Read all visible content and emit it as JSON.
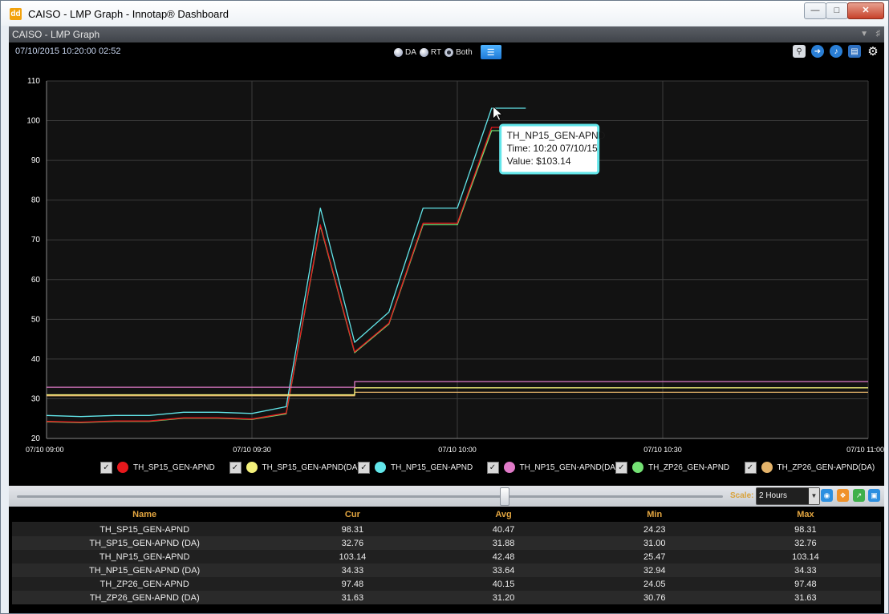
{
  "window": {
    "title": "CAISO - LMP Graph - Innotap® Dashboard",
    "app_icon": "dd"
  },
  "panel": {
    "title": "CAISO - LMP Graph"
  },
  "toolbar": {
    "timestamp": "07/10/2015 10:20:00  02:52",
    "modes": [
      {
        "label": "DA",
        "selected": false
      },
      {
        "label": "RT",
        "selected": false
      },
      {
        "label": "Both",
        "selected": true
      }
    ],
    "icons": [
      "zoom-icon",
      "forward-icon",
      "sound-icon",
      "save-icon",
      "settings-icon"
    ]
  },
  "chart_data": {
    "type": "line",
    "xlabel": "",
    "ylabel": "",
    "ylim": [
      20,
      110
    ],
    "yticks": [
      20,
      30,
      40,
      50,
      60,
      70,
      80,
      90,
      100,
      110
    ],
    "xlim": [
      "07/10 09:00",
      "07/10 11:00"
    ],
    "xticks": [
      "07/10 09:00",
      "07/10 09:30",
      "07/10 10:00",
      "07/10 10:30",
      "07/10 11:00"
    ],
    "grid": true,
    "series": [
      {
        "name": "TH_SP15_GEN-APND",
        "color": "#e8181c",
        "points": [
          [
            "09:00",
            24.3
          ],
          [
            "09:05",
            24.1
          ],
          [
            "09:10",
            24.4
          ],
          [
            "09:15",
            24.4
          ],
          [
            "09:20",
            25.2
          ],
          [
            "09:25",
            25.2
          ],
          [
            "09:30",
            24.9
          ],
          [
            "09:35",
            26.4
          ],
          [
            "09:40",
            73.8
          ],
          [
            "09:45",
            41.8
          ],
          [
            "09:50",
            49.0
          ],
          [
            "09:55",
            74.2
          ],
          [
            "10:00",
            74.2
          ],
          [
            "10:05",
            98.31
          ],
          [
            "10:10",
            98.31
          ]
        ]
      },
      {
        "name": "TH_SP15_GEN-APND(DA)",
        "color": "#f3f07a",
        "points": [
          [
            "09:00",
            31.0
          ],
          [
            "09:45",
            31.0
          ],
          [
            "09:45",
            32.76
          ],
          [
            "11:00",
            32.76
          ]
        ]
      },
      {
        "name": "TH_NP15_GEN-APND",
        "color": "#62e6ea",
        "points": [
          [
            "09:00",
            25.8
          ],
          [
            "09:05",
            25.5
          ],
          [
            "09:10",
            25.8
          ],
          [
            "09:15",
            25.8
          ],
          [
            "09:20",
            26.6
          ],
          [
            "09:25",
            26.6
          ],
          [
            "09:30",
            26.3
          ],
          [
            "09:35",
            28.0
          ],
          [
            "09:40",
            78.0
          ],
          [
            "09:45",
            44.2
          ],
          [
            "09:50",
            51.8
          ],
          [
            "09:55",
            78.0
          ],
          [
            "10:00",
            78.0
          ],
          [
            "10:05",
            103.14
          ],
          [
            "10:10",
            103.14
          ]
        ]
      },
      {
        "name": "TH_NP15_GEN-APND(DA)",
        "color": "#e07ac8",
        "points": [
          [
            "09:00",
            32.9
          ],
          [
            "09:45",
            32.9
          ],
          [
            "09:45",
            34.33
          ],
          [
            "11:00",
            34.33
          ]
        ]
      },
      {
        "name": "TH_ZP26_GEN-APND",
        "color": "#74e174",
        "points": [
          [
            "09:00",
            24.2
          ],
          [
            "09:05",
            24.0
          ],
          [
            "09:10",
            24.3
          ],
          [
            "09:15",
            24.3
          ],
          [
            "09:20",
            25.1
          ],
          [
            "09:25",
            25.1
          ],
          [
            "09:30",
            24.8
          ],
          [
            "09:35",
            26.2
          ],
          [
            "09:40",
            73.5
          ],
          [
            "09:45",
            41.6
          ],
          [
            "09:50",
            48.8
          ],
          [
            "09:55",
            73.8
          ],
          [
            "10:00",
            73.8
          ],
          [
            "10:05",
            97.48
          ],
          [
            "10:10",
            97.48
          ]
        ]
      },
      {
        "name": "TH_ZP26_GEN-APND(DA)",
        "color": "#e4b36a",
        "points": [
          [
            "09:00",
            30.76
          ],
          [
            "09:45",
            30.76
          ],
          [
            "09:45",
            31.63
          ],
          [
            "11:00",
            31.63
          ]
        ]
      }
    ],
    "tooltip": {
      "series": "TH_NP15_GEN-APND",
      "time_line": "Time: 10:20 07/10/15",
      "value_line": "Value: $103.14",
      "at_x": "10:05",
      "at_y": 103.14
    }
  },
  "legend": [
    {
      "label": "TH_SP15_GEN-APND",
      "checked": true,
      "color": "#e8181c"
    },
    {
      "label": "TH_SP15_GEN-APND(DA)",
      "checked": true,
      "color": "#f3f07a"
    },
    {
      "label": "TH_NP15_GEN-APND",
      "checked": true,
      "color": "#62e6ea"
    },
    {
      "label": "TH_NP15_GEN-APND(DA)",
      "checked": true,
      "color": "#e07ac8"
    },
    {
      "label": "TH_ZP26_GEN-APND",
      "checked": true,
      "color": "#74e174"
    },
    {
      "label": "TH_ZP26_GEN-APND(DA)",
      "checked": true,
      "color": "#e4b36a"
    }
  ],
  "scale": {
    "label": "Scale:",
    "value": "2 Hours"
  },
  "slider": {
    "position": 0.69
  },
  "table": {
    "headers": [
      "Name",
      "Cur",
      "Avg",
      "Min",
      "Max"
    ],
    "rows": [
      [
        "TH_SP15_GEN-APND",
        "98.31",
        "40.47",
        "24.23",
        "98.31"
      ],
      [
        "TH_SP15_GEN-APND (DA)",
        "32.76",
        "31.88",
        "31.00",
        "32.76"
      ],
      [
        "TH_NP15_GEN-APND",
        "103.14",
        "42.48",
        "25.47",
        "103.14"
      ],
      [
        "TH_NP15_GEN-APND (DA)",
        "34.33",
        "33.64",
        "32.94",
        "34.33"
      ],
      [
        "TH_ZP26_GEN-APND",
        "97.48",
        "40.15",
        "24.05",
        "97.48"
      ],
      [
        "TH_ZP26_GEN-APND (DA)",
        "31.63",
        "31.20",
        "30.76",
        "31.63"
      ]
    ]
  }
}
